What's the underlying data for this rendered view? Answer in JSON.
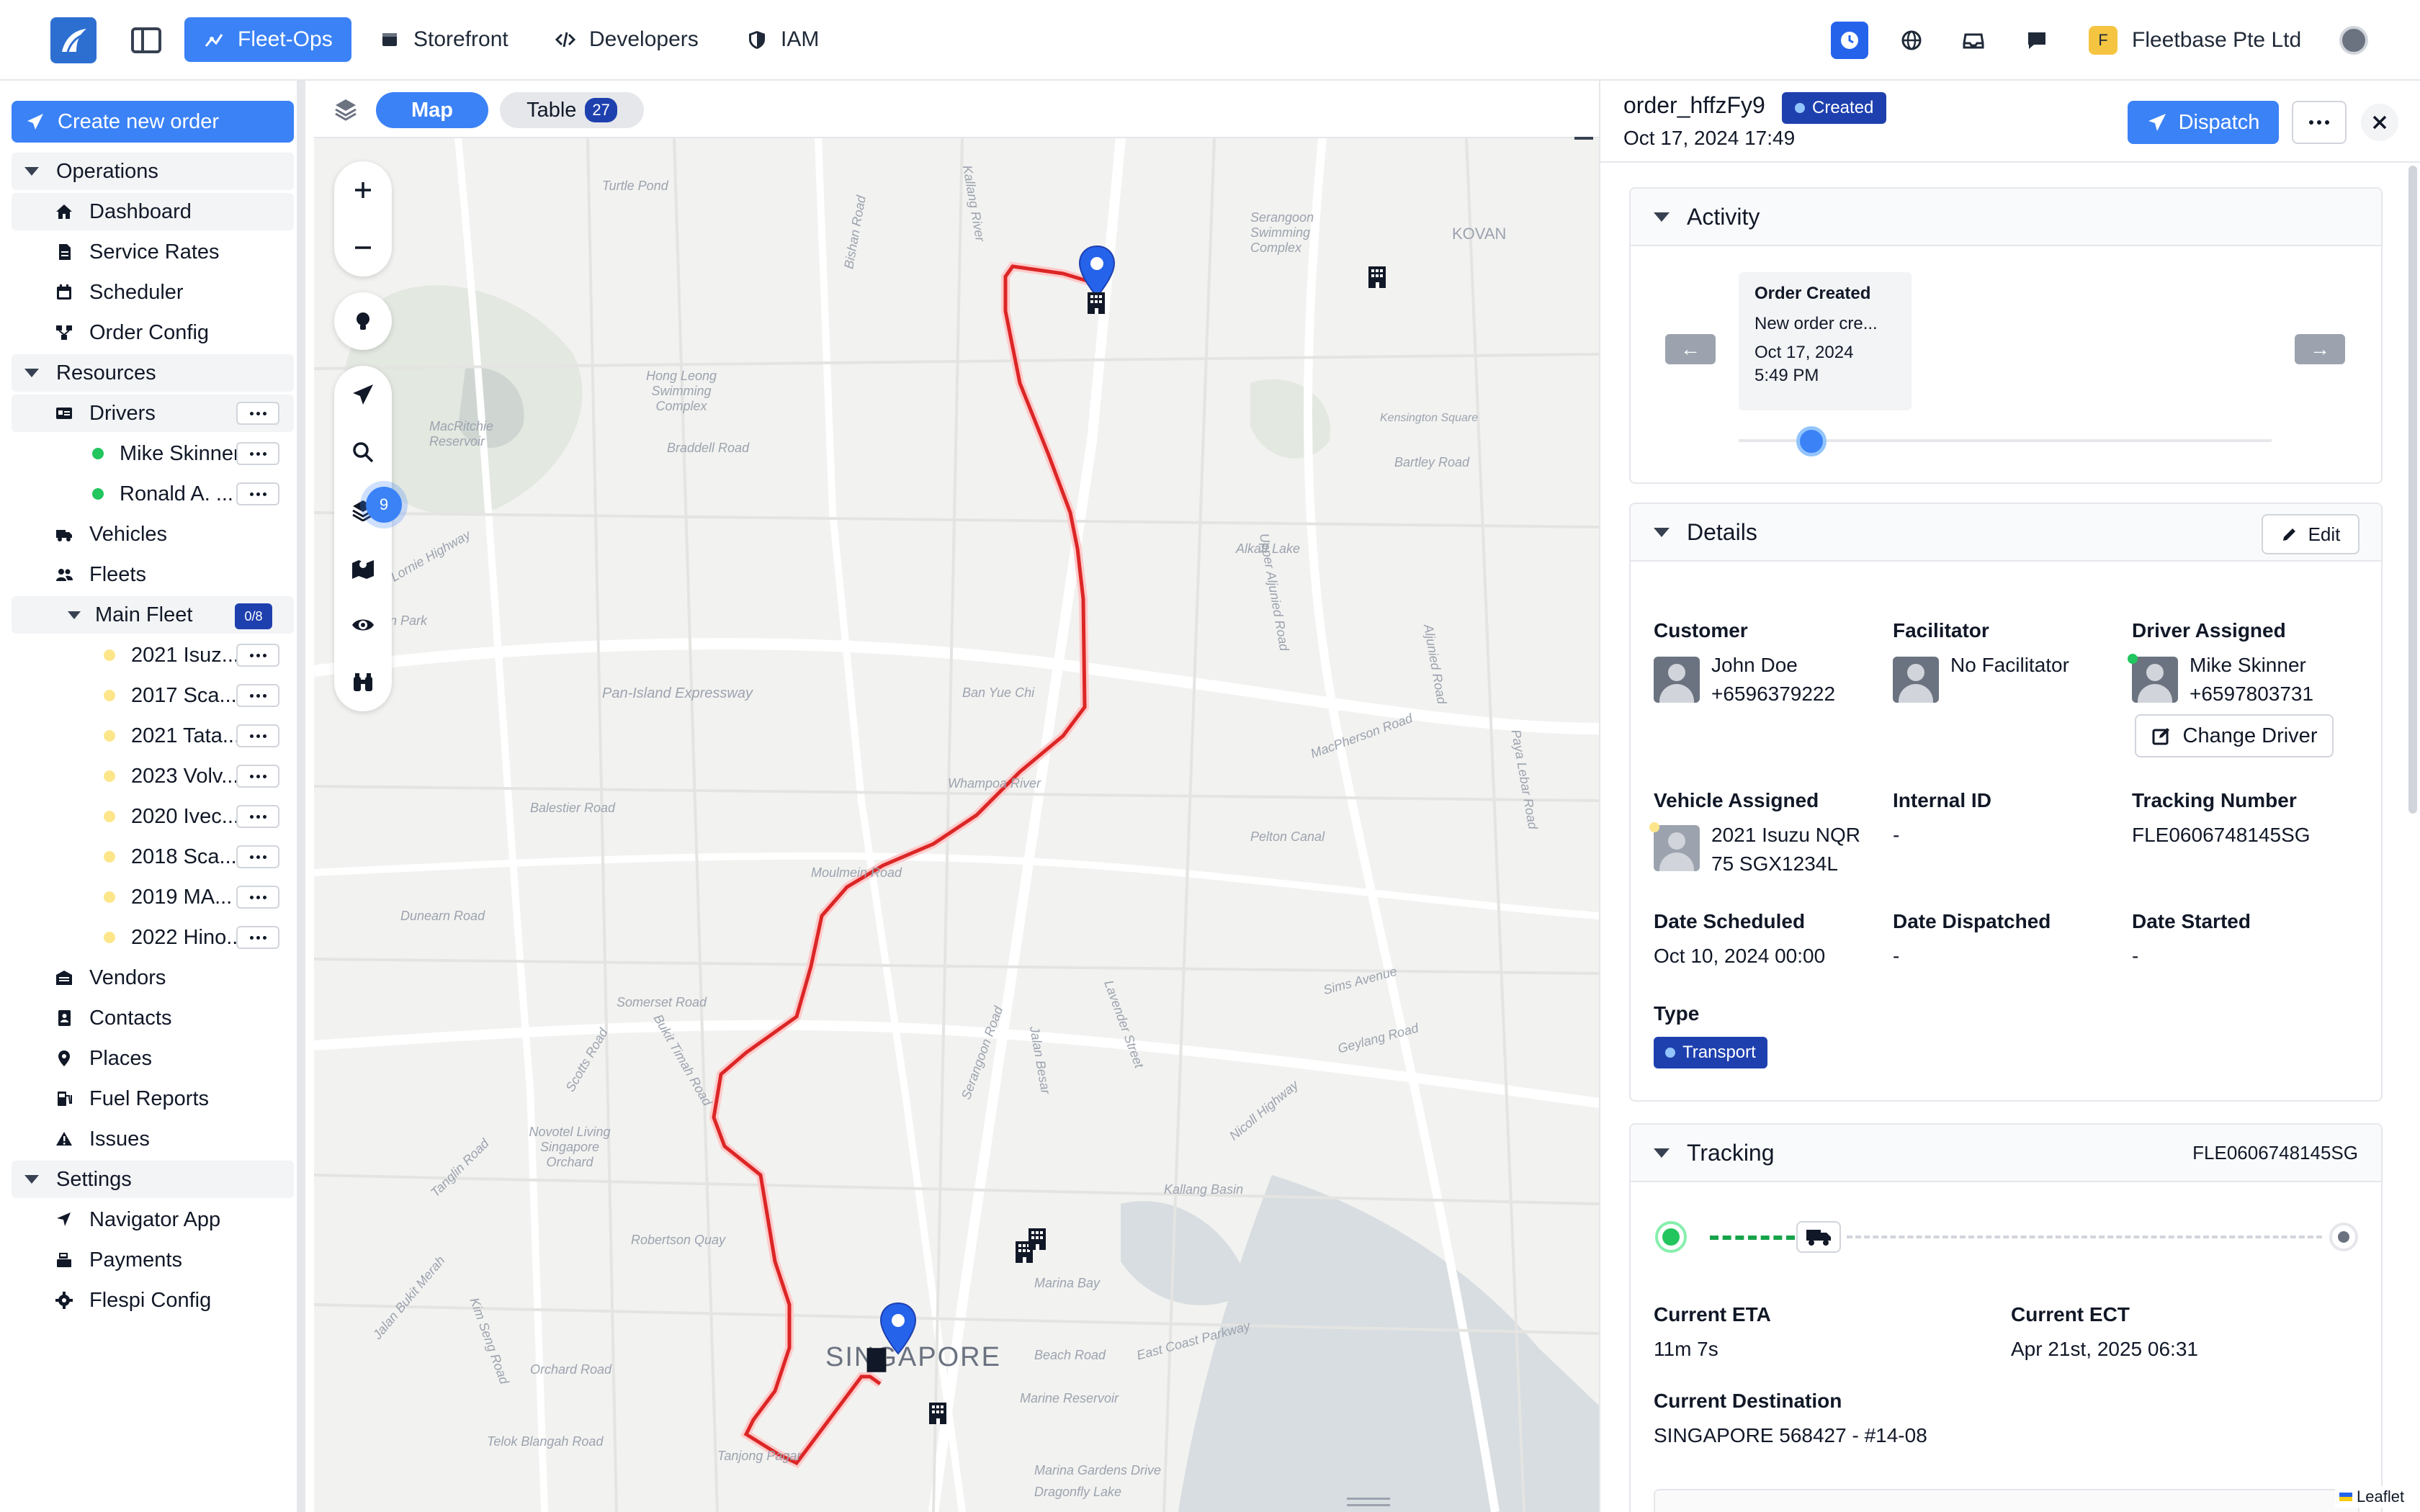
{
  "nav": {
    "tabs": [
      {
        "label": "Fleet-Ops",
        "icon": "fleet-ops-icon"
      },
      {
        "label": "Storefront",
        "icon": "storefront-icon"
      },
      {
        "label": "Developers",
        "icon": "code-icon"
      },
      {
        "label": "IAM",
        "icon": "shield-icon"
      }
    ],
    "org_initial": "F",
    "org_name": "Fleetbase Pte Ltd"
  },
  "sidebar": {
    "create_label": "Create new order",
    "sections": {
      "operations": "Operations",
      "resources": "Resources",
      "settings": "Settings"
    },
    "operations": [
      "Dashboard",
      "Service Rates",
      "Scheduler",
      "Order Config"
    ],
    "drivers_label": "Drivers",
    "drivers": [
      "Mike Skinner",
      "Ronald A. ..."
    ],
    "vehicles_label": "Vehicles",
    "fleets_label": "Fleets",
    "main_fleet_label": "Main Fleet",
    "main_fleet_count": "0/8",
    "fleet_vehicles": [
      "2021 Isuz...",
      "2017 Sca...",
      "2021 Tata...",
      "2023 Volv...",
      "2020 Ivec...",
      "2018 Sca...",
      "2019 MA...",
      "2022 Hino..."
    ],
    "resources_more": [
      "Vendors",
      "Contacts",
      "Places",
      "Fuel Reports",
      "Issues"
    ],
    "settings": [
      "Navigator App",
      "Payments",
      "Flespi Config"
    ]
  },
  "map": {
    "tab_map": "Map",
    "tab_table": "Table",
    "table_count": "27",
    "layer_count": "9",
    "city_label": "SINGAPORE",
    "attribution": "Leaflet",
    "place_labels": [
      "Turtle Pond",
      "Kallang River",
      "Bishan Road",
      "Bishan Park",
      "Hong Leong Swimming Complex",
      "MacRitchie Reservoir",
      "Lornie Highway",
      "Braddell Road",
      "Pan-Island Expressway",
      "Ban Yue Chi",
      "Whampoa River",
      "Moulmein Road",
      "Balestier Road",
      "Dunearn Road",
      "Bukit Timah Road",
      "Novotel Living Singapore Orchard",
      "Scotts Road",
      "Tanglin Road",
      "Marina Bay",
      "Kallang Basin",
      "East Coast Parkway",
      "Marine Reservoir",
      "Serangoon Swimming Complex",
      "KOVAN",
      "Bartley Road",
      "MacPherson Road",
      "Aljunied Road",
      "Sims Avenue",
      "Geylang Road",
      "Nicoll Highway",
      "Paya Lebar Road",
      "Kensington Square",
      "Alkaff Lake",
      "Upper Aljunied Road",
      "Pelton Canal",
      "Lavender Street",
      "Jalan Besar",
      "Serangoon Road",
      "Beach Road",
      "Tanjong Pagar",
      "Somerset Road",
      "Orchard Road",
      "Robertson Quay",
      "Kim Seng Road",
      "Jalan Bukit Merah",
      "Telok Blangah Road",
      "Dragonfly Lake",
      "Marina Gardens Drive"
    ]
  },
  "order": {
    "id": "order_hffzFy9",
    "status": "Created",
    "created_at": "Oct 17, 2024 17:49",
    "dispatch_label": "Dispatch"
  },
  "activity": {
    "title": "Activity",
    "item_title": "Order Created",
    "item_desc": "New order cre...",
    "item_date": "Oct 17, 2024",
    "item_time": "5:49 PM",
    "prev": "←",
    "next": "→"
  },
  "details": {
    "title": "Details",
    "edit_label": "Edit",
    "customer_label": "Customer",
    "customer_name": "John Doe",
    "customer_phone": "+6596379222",
    "facilitator_label": "Facilitator",
    "facilitator_value": "No Facilitator",
    "driver_label": "Driver Assigned",
    "driver_name": "Mike Skinner",
    "driver_phone": "+6597803731",
    "change_driver_label": "Change Driver",
    "vehicle_label": "Vehicle Assigned",
    "vehicle_line1": "2021 Isuzu NQR",
    "vehicle_line2": "75 SGX1234L",
    "internal_id_label": "Internal ID",
    "internal_id_value": "-",
    "tracking_label": "Tracking Number",
    "tracking_value": "FLE0606748145SG",
    "scheduled_label": "Date Scheduled",
    "scheduled_value": "Oct 10, 2024 00:00",
    "dispatched_label": "Date Dispatched",
    "dispatched_value": "-",
    "started_label": "Date Started",
    "started_value": "-",
    "type_label": "Type",
    "type_value": "Transport"
  },
  "tracking": {
    "title": "Tracking",
    "code": "FLE0606748145SG",
    "eta_label": "Current ETA",
    "eta_value": "11m 7s",
    "ect_label": "Current ECT",
    "ect_value": "Apr 21st, 2025 06:31",
    "dest_label": "Current Destination",
    "dest_value": "SINGAPORE 568427 - #14-08"
  },
  "colors": {
    "accent": "#3b82f6",
    "badge": "#1e40af",
    "route": "#dc2626",
    "online": "#22c55e",
    "vehicle_dot": "#fde68a"
  }
}
